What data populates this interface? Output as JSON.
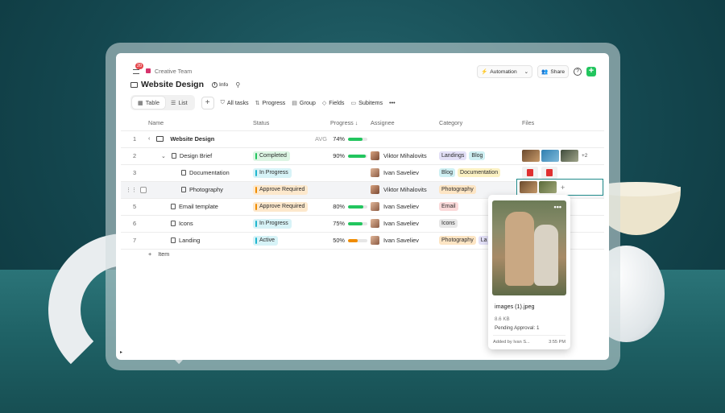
{
  "colors": {
    "accent": "#22c55e",
    "completed_bg": "#dcf5e3",
    "completed_bar": "#22c55e",
    "progress_bg": "#d7f3f7",
    "progress_bar": "#1fb6cf",
    "approve_bg": "#fde8cc",
    "approve_bar": "#f08c00",
    "active_bg": "#d7f3f7",
    "active_bar": "#1fb6cf"
  },
  "header": {
    "notifications_count": "20",
    "workspace": "Creative Team",
    "title": "Website Design",
    "info_label": "Info",
    "automation_label": "Automation",
    "share_label": "Share",
    "help_label": "?",
    "add_label": "+"
  },
  "toolbar": {
    "views": [
      {
        "label": "Table",
        "icon": "table-icon"
      },
      {
        "label": "List",
        "icon": "list-icon"
      }
    ],
    "add_view": "+",
    "all_tasks": "All tasks",
    "progress": "Progress",
    "group": "Group",
    "fields": "Fields",
    "subitems": "Subitems",
    "more": "•••"
  },
  "columns": {
    "name": "Name",
    "status": "Status",
    "progress": "Progress",
    "assignee": "Assignee",
    "category": "Category",
    "files": "Files"
  },
  "rows": [
    {
      "num": "1",
      "name": "Website Design",
      "avg_label": "AVG",
      "progress_text": "74%",
      "progress": 0.74,
      "bar_color": "#22c55e"
    },
    {
      "num": "2",
      "name": "Design Brief",
      "status": "Completed",
      "progress_text": "90%",
      "progress": 0.9,
      "assignee": "Viktor Mihalovits",
      "tags": [
        {
          "label": "Landings",
          "bg": "#e3e0f7"
        },
        {
          "label": "Blog",
          "bg": "#cff0f3"
        }
      ],
      "files_more": "+2"
    },
    {
      "num": "3",
      "name": "Documentation",
      "status": "In Progress",
      "assignee": "Ivan Saveliev",
      "tags": [
        {
          "label": "Blog",
          "bg": "#cff0f3"
        },
        {
          "label": "Documentation",
          "bg": "#fbf1c3"
        }
      ]
    },
    {
      "num": "",
      "name": "Photography",
      "status": "Approve Required",
      "assignee": "Viktor Mihalovits",
      "tags": [
        {
          "label": "Photography",
          "bg": "#fde5c4"
        }
      ],
      "files_add": "+"
    },
    {
      "num": "5",
      "name": "Email template",
      "status": "Approve Required",
      "progress_text": "80%",
      "progress": 0.8,
      "assignee": "Ivan Saveliev",
      "tags": [
        {
          "label": "Email",
          "bg": "#fbd9d9"
        }
      ]
    },
    {
      "num": "6",
      "name": "Icons",
      "status": "In Progress",
      "progress_text": "75%",
      "progress": 0.75,
      "assignee": "Ivan Saveliev",
      "tags": [
        {
          "label": "Icons",
          "bg": "#e7e7e7"
        }
      ]
    },
    {
      "num": "7",
      "name": "Landing",
      "status": "Active",
      "progress_text": "50%",
      "progress": 0.5,
      "assignee": "Ivan Saveliev",
      "tags": [
        {
          "label": "Photography",
          "bg": "#fde5c4"
        },
        {
          "label": "La",
          "bg": "#e3e0f7"
        }
      ]
    }
  ],
  "add_item": {
    "icon": "+",
    "label": "Item"
  },
  "popup": {
    "menu": "•••",
    "filename": "images (1).jpeg",
    "size": "8.6 KB",
    "pending": "Pending Approval: 1",
    "added_by": "Added by Ivan S...",
    "time": "3:55 PM"
  }
}
